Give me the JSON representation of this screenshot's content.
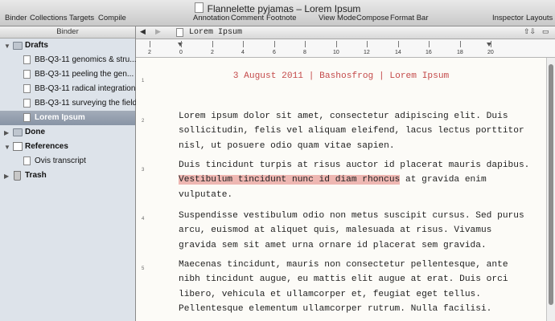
{
  "window": {
    "title": "Flannelette pyjamas – Lorem Ipsum"
  },
  "toolbar": {
    "binder": "Binder",
    "collections": "Collections",
    "targets": "Targets",
    "compile": "Compile",
    "annotation": "Annotation",
    "comment": "Comment",
    "footnote": "Footnote",
    "view_mode": "View Mode",
    "compose": "Compose",
    "format_bar": "Format Bar",
    "inspector": "Inspector",
    "layouts": "Layouts"
  },
  "binder": {
    "header": "Binder",
    "drafts": "Drafts",
    "items": [
      "BB-Q3-11 genomics & stru...",
      "BB-Q3-11 peeling the gen...",
      "BB-Q3-11 radical integration",
      "BB-Q3-11 surveying the field",
      "Lorem Ipsum"
    ],
    "done": "Done",
    "references": "References",
    "ref_items": [
      "Ovis transcript"
    ],
    "trash": "Trash"
  },
  "editor": {
    "doc_title": "Lorem Ipsum",
    "ruler_labels": [
      "2",
      "0",
      "2",
      "4",
      "6",
      "8",
      "10",
      "12",
      "14",
      "16",
      "18",
      "20"
    ],
    "header_line": "3 August 2011 | Bashosfrog | Lorem Ipsum",
    "para_numbers": [
      "1",
      "2",
      "3",
      "4",
      "5"
    ],
    "p1": [
      "Lorem ipsum dolor sit amet, consectetur adipiscing elit. Duis",
      "sollicitudin, felis vel aliquam eleifend, lacus lectus porttitor",
      "nisl, ut posuere odio quam vitae sapien."
    ],
    "p2_line1": "Duis tincidunt turpis at risus auctor id placerat mauris dapibus.",
    "p2_highlight": "Vestibulum tincidunt nunc id diam rhoncus",
    "p2_line2_rest": " at gravida enim",
    "p2_line3": "vulputate.",
    "p3": [
      "Suspendisse vestibulum odio non metus suscipit cursus. Sed purus",
      "arcu, euismod at aliquet quis, malesuada at risus. Vivamus",
      "gravida sem sit amet urna ornare id placerat sem gravida."
    ],
    "p4": [
      "Maecenas tincidunt, mauris non consectetur pellentesque, ante",
      "nibh tincidunt augue, eu mattis elit augue at erat. Duis orci",
      "libero, vehicula et ullamcorper et, feugiat eget tellus.",
      "Pellentesque elementum ullamcorper rutrum. Nulla facilisi."
    ]
  },
  "colors": {
    "header_text": "#c44b4b",
    "highlight": "#eeb7b2",
    "selection": "#8894a5"
  }
}
